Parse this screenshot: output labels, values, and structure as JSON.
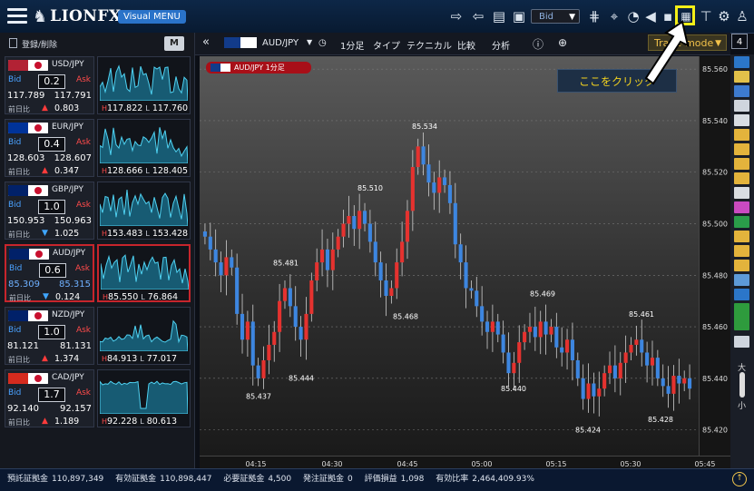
{
  "app": {
    "brand": "LIONFX",
    "menu_badge": "Visual MENU"
  },
  "toolbar": {
    "price_type": "Bid"
  },
  "sidebar": {
    "register_label": "登録/削除",
    "mode_label": "M"
  },
  "pairs": [
    {
      "name": "USD/JPY",
      "bid_label": "Bid",
      "ask_label": "Ask",
      "spread": "0.2",
      "bid": "117.789",
      "ask": "117.791",
      "change_label": "前日比",
      "change_dir": "up",
      "change": "0.803",
      "high": "117.822",
      "low": "117.760",
      "flag_colors": [
        "#b22234",
        "#3c3b6e"
      ],
      "selected": false
    },
    {
      "name": "EUR/JPY",
      "bid_label": "Bid",
      "ask_label": "Ask",
      "spread": "0.4",
      "bid": "128.603",
      "ask": "128.607",
      "change_label": "前日比",
      "change_dir": "up",
      "change": "0.347",
      "high": "128.666",
      "low": "128.405",
      "flag_colors": [
        "#003399",
        "#003399"
      ],
      "selected": false
    },
    {
      "name": "GBP/JPY",
      "bid_label": "Bid",
      "ask_label": "Ask",
      "spread": "1.0",
      "bid": "150.953",
      "ask": "150.963",
      "change_label": "前日比",
      "change_dir": "down",
      "change": "1.025",
      "high": "153.483",
      "low": "153.428",
      "flag_colors": [
        "#012169",
        "#c8102e"
      ],
      "selected": false
    },
    {
      "name": "AUD/JPY",
      "bid_label": "Bid",
      "ask_label": "Ask",
      "spread": "0.6",
      "bid": "85.309",
      "ask": "85.315",
      "change_label": "前日比",
      "change_dir": "down",
      "change": "0.124",
      "high": "85.550",
      "low": "76.864",
      "flag_colors": [
        "#012169",
        "#012169"
      ],
      "selected": true
    },
    {
      "name": "NZD/JPY",
      "bid_label": "Bid",
      "ask_label": "Ask",
      "spread": "1.0",
      "bid": "81.121",
      "ask": "81.131",
      "change_label": "前日比",
      "change_dir": "up",
      "change": "1.374",
      "high": "84.913",
      "low": "77.017",
      "flag_colors": [
        "#012169",
        "#012169"
      ],
      "selected": false
    },
    {
      "name": "CAD/JPY",
      "bid_label": "Bid",
      "ask_label": "Ask",
      "spread": "1.7",
      "bid": "92.140",
      "ask": "92.157",
      "change_label": "前日比",
      "change_dir": "up",
      "change": "1.189",
      "high": "92.228",
      "low": "80.613",
      "flag_colors": [
        "#d52b1e",
        "#d52b1e"
      ],
      "selected": false
    }
  ],
  "chart_toolbar": {
    "pair": "AUD/JPY",
    "interval": "1分足",
    "type": "タイプ",
    "technical": "テクニカル",
    "compare": "比較",
    "analysis": "分析",
    "mode": "Trade-mode",
    "chart_count": "4"
  },
  "chart": {
    "legend": "AUD/JPY 1分足",
    "callout": "ここをクリック"
  },
  "chart_data": {
    "type": "candlestick",
    "pair": "AUD/JPY",
    "interval": "1分足",
    "y_axis_ticks": [
      85.42,
      85.44,
      85.46,
      85.48,
      85.5,
      85.52,
      85.54,
      85.56
    ],
    "ylim": [
      85.41,
      85.565
    ],
    "x_axis_ticks": [
      "04:15",
      "04:30",
      "04:45",
      "05:00",
      "05:15",
      "05:30",
      "05:45"
    ],
    "annotations": [
      {
        "label": "85.481",
        "price": 85.481
      },
      {
        "label": "85.437",
        "price": 85.437
      },
      {
        "label": "85.444",
        "price": 85.444
      },
      {
        "label": "85.510",
        "price": 85.51
      },
      {
        "label": "85.468",
        "price": 85.468
      },
      {
        "label": "85.534",
        "price": 85.534
      },
      {
        "label": "85.469",
        "price": 85.469
      },
      {
        "label": "85.440",
        "price": 85.44
      },
      {
        "label": "85.424",
        "price": 85.424
      },
      {
        "label": "85.461",
        "price": 85.461
      },
      {
        "label": "85.428",
        "price": 85.428
      }
    ],
    "closes": [
      85.495,
      85.49,
      85.485,
      85.48,
      85.487,
      85.483,
      85.465,
      85.455,
      85.462,
      85.445,
      85.44,
      85.447,
      85.453,
      85.458,
      85.47,
      85.475,
      85.468,
      85.46,
      85.455,
      85.465,
      85.478,
      85.485,
      85.49,
      85.482,
      85.49,
      85.495,
      85.5,
      85.503,
      85.498,
      85.505,
      85.5,
      85.493,
      85.485,
      85.478,
      85.472,
      85.475,
      85.485,
      85.493,
      85.505,
      85.522,
      85.53,
      85.523,
      85.516,
      85.512,
      85.518,
      85.515,
      85.508,
      85.492,
      85.485,
      85.475,
      85.474,
      85.468,
      85.462,
      85.458,
      85.462,
      85.457,
      85.45,
      85.442,
      85.446,
      85.454,
      85.458,
      85.46,
      85.456,
      85.462,
      85.457,
      85.46,
      85.452,
      85.45,
      85.455,
      85.447,
      85.44,
      85.432,
      85.438,
      85.433,
      85.436,
      85.442,
      85.445,
      85.44,
      85.446,
      85.45,
      85.453,
      85.455,
      85.45,
      85.445,
      85.448,
      85.44,
      85.437,
      85.434,
      85.441,
      85.438,
      85.44,
      85.436
    ]
  },
  "status": {
    "items": [
      {
        "label": "預託証拠金",
        "value": "110,897,349"
      },
      {
        "label": "有効証拠金",
        "value": "110,898,447"
      },
      {
        "label": "必要証拠金",
        "value": "4,500"
      },
      {
        "label": "発注証拠金",
        "value": "0"
      },
      {
        "label": "評価損益",
        "value": "1,098"
      },
      {
        "label": "有効比率",
        "value": "2,464,409.93%"
      }
    ]
  }
}
